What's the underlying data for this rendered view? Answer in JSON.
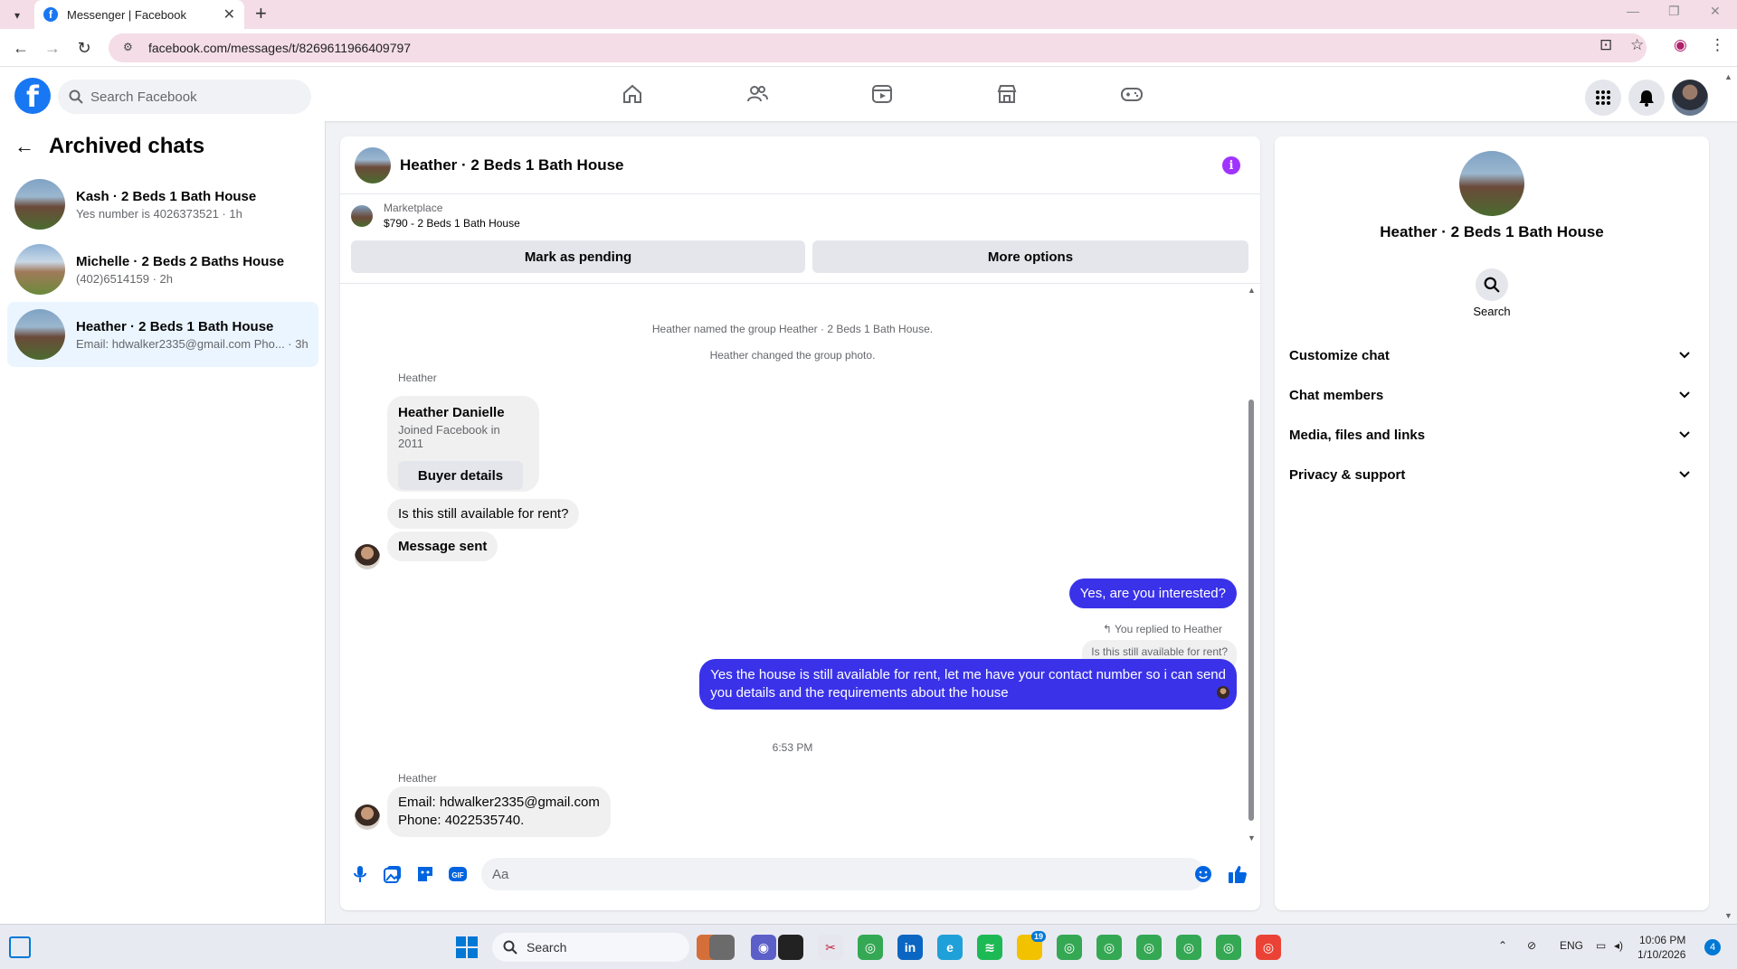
{
  "browser": {
    "tab_title": "Messenger | Facebook",
    "url": "facebook.com/messages/t/8269611966409797"
  },
  "header": {
    "search_placeholder": "Search Facebook"
  },
  "left_panel": {
    "title": "Archived chats",
    "chats": [
      {
        "name": "Kash · 2 Beds 1 Bath House",
        "preview": "Yes number is 4026373521 · 1h"
      },
      {
        "name": "Michelle · 2 Beds 2 Baths House",
        "preview": "(402)6514159 · 2h"
      },
      {
        "name": "Heather · 2 Beds 1 Bath House",
        "preview": "Email: hdwalker2335@gmail.com Pho... · 3h"
      }
    ]
  },
  "chat": {
    "title": "Heather · 2 Beds 1 Bath House",
    "marketplace_label": "Marketplace",
    "listing": "$790 - 2 Beds 1 Bath House",
    "mark_pending": "Mark as pending",
    "more_options": "More options",
    "system_msgs": [
      "Heather named the group Heather · 2 Beds 1 Bath House.",
      "Heather changed the group photo."
    ],
    "sender_name": "Heather",
    "card_name": "Heather Danielle",
    "card_sub": "Joined Facebook in 2011",
    "card_button": "Buyer details",
    "msg_in_1": "Is this still available for rent?",
    "msg_in_2": "Message sent",
    "msg_out_1": "Yes, are you interested?",
    "reply_note": "You replied to Heather",
    "reply_quote": "Is this still available for rent?",
    "msg_out_2_line1": "Yes the house is still available for rent, let me have your contact number so i can send",
    "msg_out_2_line2": "you details and the requirements about the house",
    "timestamp": "6:53 PM",
    "msg_in_3_line1": "Email: hdwalker2335@gmail.com",
    "msg_in_3_line2": "Phone: 4022535740.",
    "composer_placeholder": "Aa",
    "gif_label": "GIF"
  },
  "right_panel": {
    "name": "Heather · 2 Beds 1 Bath House",
    "search_label": "Search",
    "sections": [
      "Customize chat",
      "Chat members",
      "Media, files and links",
      "Privacy & support"
    ]
  },
  "taskbar": {
    "search": "Search",
    "lang": "ENG",
    "time": "10:06 PM",
    "date": "1/10/2026",
    "notif_count": "4",
    "app_badge": "19"
  },
  "colors": {
    "accent": "#1877f2",
    "outgoing_bubble": "#3a32e8",
    "info": "#a033ff"
  }
}
